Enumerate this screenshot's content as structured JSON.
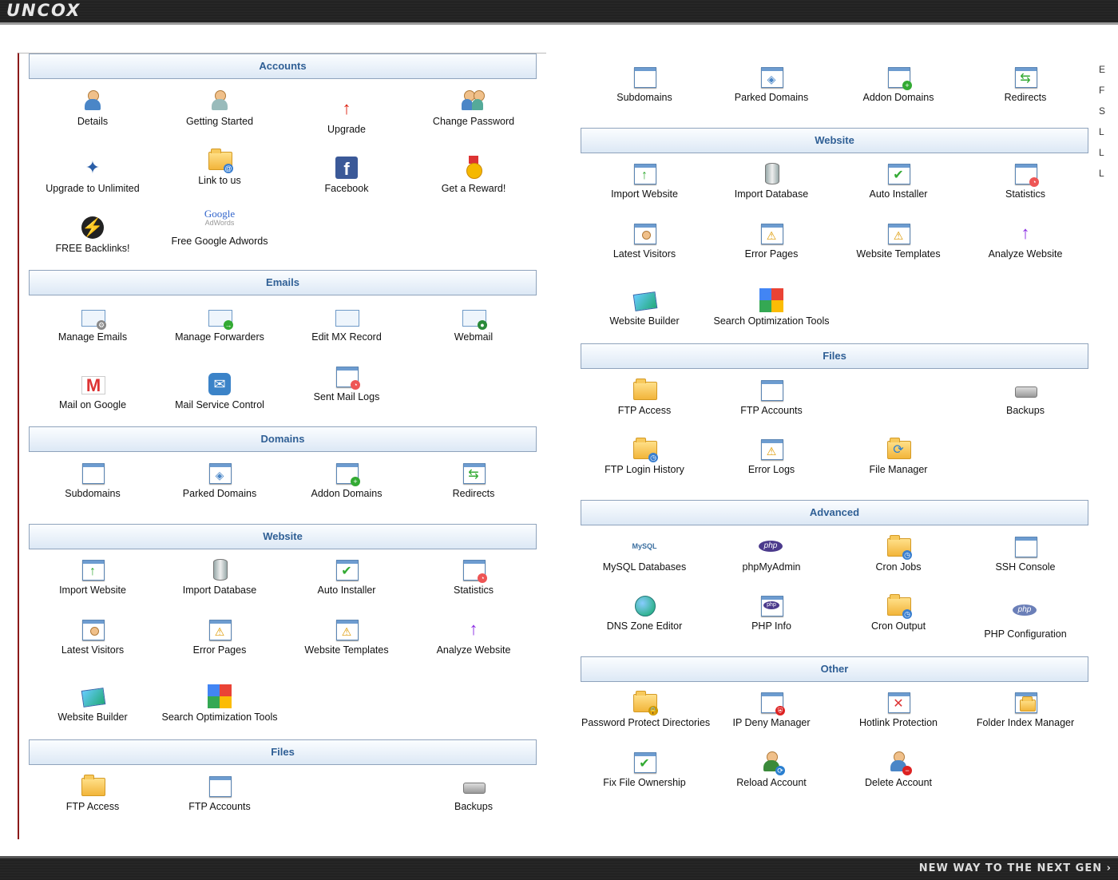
{
  "brand": {
    "logo": "UNCOX",
    "tagline": "NEW WAY TO THE NEXT GEN ›"
  },
  "left": {
    "accounts": {
      "header": "Accounts",
      "items": [
        {
          "label": "Details",
          "icon": "user-details-icon"
        },
        {
          "label": "Getting Started",
          "icon": "getting-started-icon"
        },
        {
          "label": "Upgrade",
          "icon": "upgrade-icon"
        },
        {
          "label": "Change Password",
          "icon": "change-password-icon"
        },
        {
          "label": "Upgrade to Unlimited",
          "icon": "unlimited-icon"
        },
        {
          "label": "Link to us",
          "icon": "link-folder-icon"
        },
        {
          "label": "Facebook",
          "icon": "facebook-icon"
        },
        {
          "label": "Get a Reward!",
          "icon": "reward-medal-icon"
        },
        {
          "label": "FREE Backlinks!",
          "icon": "backlinks-icon"
        },
        {
          "label": "Free Google Adwords",
          "icon": "google-adwords-icon",
          "logo_text": "Google",
          "logo_sub": "AdWords"
        }
      ]
    },
    "emails": {
      "header": "Emails",
      "items": [
        {
          "label": "Manage Emails",
          "icon": "manage-emails-icon"
        },
        {
          "label": "Manage Forwarders",
          "icon": "forwarders-icon"
        },
        {
          "label": "Edit MX Record",
          "icon": "mx-record-icon"
        },
        {
          "label": "Webmail",
          "icon": "webmail-icon"
        },
        {
          "label": "Mail on Google",
          "icon": "gmail-icon"
        },
        {
          "label": "Mail Service Control",
          "icon": "mail-service-icon"
        },
        {
          "label": "Sent Mail Logs",
          "icon": "mail-logs-icon"
        }
      ]
    },
    "domains": {
      "header": "Domains",
      "items": [
        {
          "label": "Subdomains",
          "icon": "subdomains-icon"
        },
        {
          "label": "Parked Domains",
          "icon": "parked-domains-icon"
        },
        {
          "label": "Addon Domains",
          "icon": "addon-domains-icon"
        },
        {
          "label": "Redirects",
          "icon": "redirects-icon"
        }
      ]
    },
    "website": {
      "header": "Website",
      "items": [
        {
          "label": "Import Website",
          "icon": "import-website-icon"
        },
        {
          "label": "Import Database",
          "icon": "import-database-icon"
        },
        {
          "label": "Auto Installer",
          "icon": "auto-installer-icon"
        },
        {
          "label": "Statistics",
          "icon": "statistics-icon"
        },
        {
          "label": "Latest Visitors",
          "icon": "latest-visitors-icon"
        },
        {
          "label": "Error Pages",
          "icon": "error-pages-icon"
        },
        {
          "label": "Website Templates",
          "icon": "website-templates-icon"
        },
        {
          "label": "Analyze Website",
          "icon": "analyze-website-icon"
        },
        {
          "label": "Website Builder",
          "icon": "website-builder-icon"
        },
        {
          "label": "Search Optimization Tools",
          "icon": "seo-tools-icon"
        }
      ]
    },
    "files": {
      "header": "Files",
      "items": [
        {
          "label": "FTP Access",
          "icon": "ftp-access-icon"
        },
        {
          "label": "FTP Accounts",
          "icon": "ftp-accounts-icon"
        },
        {
          "label": "Backups",
          "icon": "backups-icon"
        }
      ]
    }
  },
  "right": {
    "domains": {
      "items": [
        {
          "label": "Subdomains",
          "icon": "subdomains-icon"
        },
        {
          "label": "Parked Domains",
          "icon": "parked-domains-icon"
        },
        {
          "label": "Addon Domains",
          "icon": "addon-domains-icon"
        },
        {
          "label": "Redirects",
          "icon": "redirects-icon"
        }
      ]
    },
    "website": {
      "header": "Website",
      "items": [
        {
          "label": "Import Website",
          "icon": "import-website-icon"
        },
        {
          "label": "Import Database",
          "icon": "import-database-icon"
        },
        {
          "label": "Auto Installer",
          "icon": "auto-installer-icon"
        },
        {
          "label": "Statistics",
          "icon": "statistics-icon"
        },
        {
          "label": "Latest Visitors",
          "icon": "latest-visitors-icon"
        },
        {
          "label": "Error Pages",
          "icon": "error-pages-icon"
        },
        {
          "label": "Website Templates",
          "icon": "website-templates-icon"
        },
        {
          "label": "Analyze Website",
          "icon": "analyze-website-icon"
        },
        {
          "label": "Website Builder",
          "icon": "website-builder-icon"
        },
        {
          "label": "Search Optimization Tools",
          "icon": "seo-tools-icon"
        }
      ]
    },
    "files": {
      "header": "Files",
      "items": [
        {
          "label": "FTP Access",
          "icon": "ftp-access-icon"
        },
        {
          "label": "FTP Accounts",
          "icon": "ftp-accounts-icon"
        },
        {
          "label": "Backups",
          "icon": "backups-icon"
        },
        {
          "label": "FTP Login History",
          "icon": "ftp-login-history-icon"
        },
        {
          "label": "Error Logs",
          "icon": "error-logs-icon"
        },
        {
          "label": "File Manager",
          "icon": "file-manager-icon"
        }
      ]
    },
    "advanced": {
      "header": "Advanced",
      "items": [
        {
          "label": "MySQL Databases",
          "icon": "mysql-icon",
          "logo_text": "MySQL"
        },
        {
          "label": "phpMyAdmin",
          "icon": "phpmyadmin-icon",
          "logo_text": "php"
        },
        {
          "label": "Cron Jobs",
          "icon": "cron-jobs-icon"
        },
        {
          "label": "SSH Console",
          "icon": "ssh-console-icon"
        },
        {
          "label": "DNS Zone Editor",
          "icon": "dns-zone-icon"
        },
        {
          "label": "PHP Info",
          "icon": "php-info-icon",
          "logo_text": "php"
        },
        {
          "label": "Cron Output",
          "icon": "cron-output-icon"
        },
        {
          "label": "PHP Configuration",
          "icon": "php-config-icon",
          "logo_text": "php"
        }
      ]
    },
    "other": {
      "header": "Other",
      "items": [
        {
          "label": "Password Protect Directories",
          "icon": "password-protect-icon"
        },
        {
          "label": "IP Deny Manager",
          "icon": "ip-deny-icon"
        },
        {
          "label": "Hotlink Protection",
          "icon": "hotlink-icon"
        },
        {
          "label": "Folder Index Manager",
          "icon": "folder-index-icon"
        },
        {
          "label": "Fix File Ownership",
          "icon": "fix-ownership-icon"
        },
        {
          "label": "Reload Account",
          "icon": "reload-account-icon"
        },
        {
          "label": "Delete Account",
          "icon": "delete-account-icon"
        }
      ]
    }
  },
  "right_edge_letters": [
    "E",
    "F",
    "S",
    "L",
    "L",
    "L"
  ]
}
